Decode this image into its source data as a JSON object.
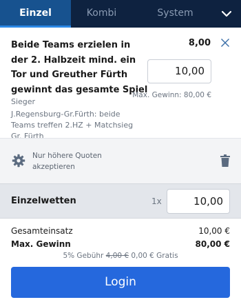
{
  "tabs": {
    "einzel": "Einzel",
    "kombi": "Kombi",
    "system": "System"
  },
  "bet": {
    "title": "Beide Teams erzielen in der 2. Halbzeit mind. ein Tor und Greuther Fürth gewinnt das gesamte Spiel",
    "odds": "8,00",
    "stake": "10,00",
    "max_win": "Max. Gewinn: 80,00 €",
    "market": "Sieger",
    "selection": "J.Regensburg-Gr.Fürth: beide Teams treffen 2.HZ + Matchsieg Gr. Fürth"
  },
  "settings": {
    "label": "Nur höhere Quoten akzeptieren"
  },
  "einzelwetten": {
    "label": "Einzelwetten",
    "multiplier": "1x",
    "stake": "10,00"
  },
  "summary": {
    "gesamteinsatz_label": "Gesamteinsatz",
    "gesamteinsatz_value": "10,00 €",
    "max_gewinn_label": "Max. Gewinn",
    "max_gewinn_value": "80,00 €",
    "fee_prefix": "5% Gebühr",
    "fee_old": "4,00 €",
    "fee_new": "0,00 € Gratis"
  },
  "login_label": "Login",
  "colors": {
    "header": "#0e2240",
    "active_tab": "#17528f",
    "accent": "#2568dd"
  }
}
